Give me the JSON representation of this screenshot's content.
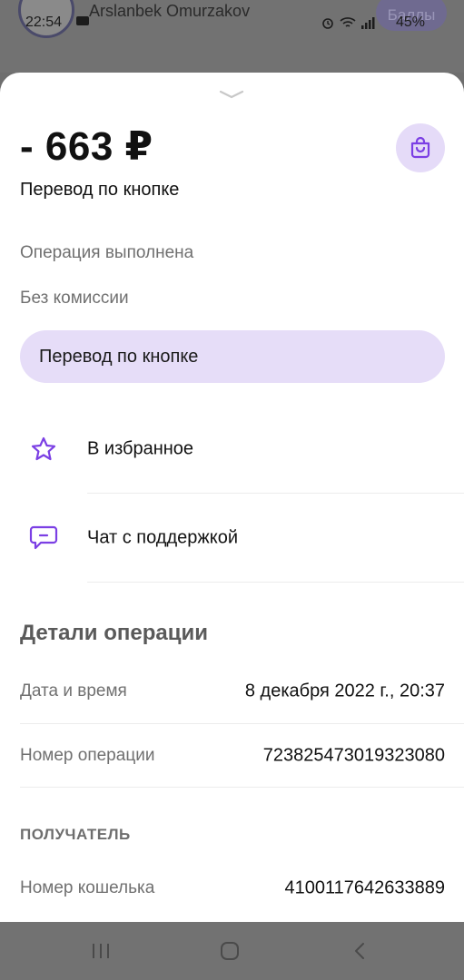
{
  "status_bar": {
    "time": "22:54",
    "battery": "45%",
    "background_name": "Arslanbek Omurzakov",
    "background_pill": "Баллы"
  },
  "header": {
    "amount": "- 663 ₽",
    "title": "Перевод по кнопке"
  },
  "info": {
    "status": "Операция выполнена",
    "fee": "Без комиссии",
    "category": "Перевод по кнопке"
  },
  "actions": [
    {
      "label": "В избранное",
      "icon": "star-icon"
    },
    {
      "label": "Чат с поддержкой",
      "icon": "chat-icon"
    }
  ],
  "details": {
    "title": "Детали операции",
    "rows": [
      {
        "label": "Дата и время",
        "value": "8 декабря 2022 г., 20:37"
      },
      {
        "label": "Номер операции",
        "value": "723825473019323080"
      }
    ]
  },
  "recipient": {
    "title": "ПОЛУЧАТЕЛЬ",
    "rows": [
      {
        "label": "Номер кошелька",
        "value": "4100117642633889"
      }
    ]
  },
  "colors": {
    "accent": "#7b3fe4",
    "accent_light": "#e6ddf8",
    "dim_overlay": "#6e6e6e"
  }
}
